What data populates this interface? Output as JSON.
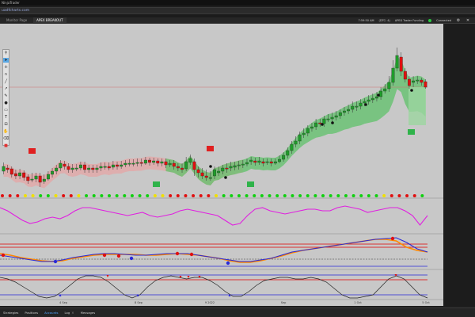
{
  "window": {
    "title": "NinjaTrader"
  },
  "browser": {
    "url": "uadfcharts.com"
  },
  "toolbar": {
    "tabs": [
      {
        "label": "Monitor Page"
      },
      {
        "label": "APEX BREAKOUT"
      }
    ],
    "time": "7:59:50 AM",
    "balance": "(DTC: 4)",
    "indicator_name": "APEX Trader Funding",
    "connection_label": "Connected"
  },
  "drawing_tools": [
    {
      "icon": "pin-icon"
    },
    {
      "icon": "cursor-icon"
    },
    {
      "icon": "crosshair-icon"
    },
    {
      "icon": "magnet-icon"
    },
    {
      "icon": "line-icon"
    },
    {
      "icon": "ray-icon"
    },
    {
      "icon": "pencil-icon"
    },
    {
      "icon": "dot-icon"
    },
    {
      "icon": "rectangle-icon"
    },
    {
      "icon": "text-icon"
    },
    {
      "icon": "ruler-icon"
    },
    {
      "icon": "hand-icon"
    },
    {
      "icon": "trash-icon"
    },
    {
      "icon": "color-icon"
    }
  ],
  "time_axis": {
    "labels": [
      "4 Sep",
      "8 Sep",
      "9 2022",
      "Sep",
      "1 Oct",
      "5 Oct"
    ]
  },
  "bottom_tabs": [
    {
      "label": "Strategies"
    },
    {
      "label": "Positions"
    },
    {
      "label": "Accounts"
    },
    {
      "label": "Log"
    },
    {
      "label": "Messages"
    }
  ],
  "colors": {
    "bull": "#1f9c2a",
    "bear": "#e01010",
    "band_green": "#5fc26a",
    "band_red": "#e7a3a3",
    "oscillator": "#e020e0",
    "macd_blue": "#2a2ad8",
    "macd_orange": "#ff8800"
  },
  "chart_data": {
    "type": "candlestick",
    "candles": [
      {
        "o": 216,
        "c": 210,
        "h": 205,
        "l": 220
      },
      {
        "o": 212,
        "c": 214,
        "h": 208,
        "l": 218
      },
      {
        "o": 213,
        "c": 220,
        "h": 210,
        "l": 224
      },
      {
        "o": 219,
        "c": 222,
        "h": 214,
        "l": 226
      },
      {
        "o": 222,
        "c": 218,
        "h": 213,
        "l": 226
      },
      {
        "o": 218,
        "c": 224,
        "h": 215,
        "l": 228
      },
      {
        "o": 223,
        "c": 228,
        "h": 220,
        "l": 232
      },
      {
        "o": 226,
        "c": 226,
        "h": 218,
        "l": 230
      },
      {
        "o": 226,
        "c": 222,
        "h": 218,
        "l": 230
      },
      {
        "o": 222,
        "c": 230,
        "h": 218,
        "l": 236
      },
      {
        "o": 229,
        "c": 226,
        "h": 220,
        "l": 232
      },
      {
        "o": 226,
        "c": 220,
        "h": 216,
        "l": 228
      },
      {
        "o": 220,
        "c": 216,
        "h": 212,
        "l": 224
      },
      {
        "o": 216,
        "c": 212,
        "h": 208,
        "l": 220
      },
      {
        "o": 212,
        "c": 206,
        "h": 202,
        "l": 216
      },
      {
        "o": 207,
        "c": 210,
        "h": 203,
        "l": 214
      },
      {
        "o": 210,
        "c": 214,
        "h": 206,
        "l": 218
      },
      {
        "o": 214,
        "c": 212,
        "h": 207,
        "l": 218
      },
      {
        "o": 212,
        "c": 212,
        "h": 207,
        "l": 216
      },
      {
        "o": 212,
        "c": 208,
        "h": 204,
        "l": 215
      },
      {
        "o": 208,
        "c": 214,
        "h": 204,
        "l": 218
      },
      {
        "o": 214,
        "c": 212,
        "h": 208,
        "l": 218
      },
      {
        "o": 212,
        "c": 214,
        "h": 208,
        "l": 218
      },
      {
        "o": 214,
        "c": 212,
        "h": 208,
        "l": 218
      },
      {
        "o": 212,
        "c": 210,
        "h": 205,
        "l": 216
      },
      {
        "o": 210,
        "c": 210,
        "h": 205,
        "l": 214
      },
      {
        "o": 210,
        "c": 212,
        "h": 205,
        "l": 215
      },
      {
        "o": 211,
        "c": 208,
        "h": 203,
        "l": 214
      },
      {
        "o": 208,
        "c": 210,
        "h": 204,
        "l": 214
      },
      {
        "o": 210,
        "c": 208,
        "h": 203,
        "l": 213
      },
      {
        "o": 208,
        "c": 206,
        "h": 202,
        "l": 211
      },
      {
        "o": 206,
        "c": 206,
        "h": 201,
        "l": 210
      },
      {
        "o": 206,
        "c": 206,
        "h": 201,
        "l": 210
      },
      {
        "o": 206,
        "c": 205,
        "h": 200,
        "l": 210
      },
      {
        "o": 205,
        "c": 206,
        "h": 200,
        "l": 210
      },
      {
        "o": 206,
        "c": 202,
        "h": 198,
        "l": 208
      },
      {
        "o": 202,
        "c": 205,
        "h": 199,
        "l": 209
      },
      {
        "o": 205,
        "c": 203,
        "h": 199,
        "l": 208
      },
      {
        "o": 203,
        "c": 206,
        "h": 200,
        "l": 210
      },
      {
        "o": 206,
        "c": 204,
        "h": 200,
        "l": 210
      },
      {
        "o": 204,
        "c": 208,
        "h": 200,
        "l": 212
      },
      {
        "o": 208,
        "c": 206,
        "h": 202,
        "l": 211
      },
      {
        "o": 206,
        "c": 210,
        "h": 202,
        "l": 214
      },
      {
        "o": 210,
        "c": 212,
        "h": 206,
        "l": 216
      },
      {
        "o": 212,
        "c": 214,
        "h": 206,
        "l": 218
      },
      {
        "o": 213,
        "c": 204,
        "h": 198,
        "l": 216
      },
      {
        "o": 205,
        "c": 200,
        "h": 195,
        "l": 208
      },
      {
        "o": 204,
        "c": 214,
        "h": 200,
        "l": 222
      },
      {
        "o": 214,
        "c": 218,
        "h": 210,
        "l": 224
      },
      {
        "o": 218,
        "c": 222,
        "h": 212,
        "l": 226
      },
      {
        "o": 222,
        "c": 224,
        "h": 214,
        "l": 228
      },
      {
        "o": 224,
        "c": 224,
        "h": 216,
        "l": 228
      },
      {
        "o": 222,
        "c": 214,
        "h": 210,
        "l": 226
      },
      {
        "o": 218,
        "c": 216,
        "h": 210,
        "l": 222
      },
      {
        "o": 216,
        "c": 212,
        "h": 208,
        "l": 220
      },
      {
        "o": 212,
        "c": 213,
        "h": 206,
        "l": 218
      },
      {
        "o": 212,
        "c": 210,
        "h": 204,
        "l": 216
      },
      {
        "o": 211,
        "c": 209,
        "h": 204,
        "l": 215
      },
      {
        "o": 209,
        "c": 208,
        "h": 203,
        "l": 214
      },
      {
        "o": 208,
        "c": 207,
        "h": 202,
        "l": 212
      },
      {
        "o": 207,
        "c": 205,
        "h": 200,
        "l": 210
      },
      {
        "o": 204,
        "c": 202,
        "h": 198,
        "l": 208
      },
      {
        "o": 203,
        "c": 205,
        "h": 199,
        "l": 209
      },
      {
        "o": 205,
        "c": 203,
        "h": 198,
        "l": 208
      },
      {
        "o": 204,
        "c": 206,
        "h": 200,
        "l": 210
      },
      {
        "o": 205,
        "c": 204,
        "h": 200,
        "l": 208
      },
      {
        "o": 204,
        "c": 206,
        "h": 200,
        "l": 210
      },
      {
        "o": 206,
        "c": 204,
        "h": 200,
        "l": 208
      },
      {
        "o": 204,
        "c": 201,
        "h": 196,
        "l": 206
      },
      {
        "o": 201,
        "c": 196,
        "h": 192,
        "l": 204
      },
      {
        "o": 196,
        "c": 190,
        "h": 186,
        "l": 200
      },
      {
        "o": 190,
        "c": 182,
        "h": 178,
        "l": 194
      },
      {
        "o": 182,
        "c": 178,
        "h": 172,
        "l": 186
      },
      {
        "o": 178,
        "c": 170,
        "h": 166,
        "l": 182
      },
      {
        "o": 170,
        "c": 168,
        "h": 162,
        "l": 174
      },
      {
        "o": 168,
        "c": 162,
        "h": 158,
        "l": 172
      },
      {
        "o": 162,
        "c": 160,
        "h": 155,
        "l": 166
      },
      {
        "o": 160,
        "c": 155,
        "h": 150,
        "l": 164
      },
      {
        "o": 155,
        "c": 156,
        "h": 150,
        "l": 160
      },
      {
        "o": 156,
        "c": 150,
        "h": 146,
        "l": 160
      },
      {
        "o": 150,
        "c": 150,
        "h": 144,
        "l": 154
      },
      {
        "o": 150,
        "c": 148,
        "h": 142,
        "l": 154
      },
      {
        "o": 148,
        "c": 146,
        "h": 140,
        "l": 152
      },
      {
        "o": 146,
        "c": 142,
        "h": 138,
        "l": 150
      },
      {
        "o": 142,
        "c": 140,
        "h": 135,
        "l": 146
      },
      {
        "o": 140,
        "c": 138,
        "h": 132,
        "l": 144
      },
      {
        "o": 138,
        "c": 134,
        "h": 128,
        "l": 142
      },
      {
        "o": 134,
        "c": 134,
        "h": 128,
        "l": 140
      },
      {
        "o": 134,
        "c": 130,
        "h": 125,
        "l": 138
      },
      {
        "o": 130,
        "c": 128,
        "h": 124,
        "l": 134
      },
      {
        "o": 128,
        "c": 126,
        "h": 120,
        "l": 132
      },
      {
        "o": 126,
        "c": 124,
        "h": 118,
        "l": 130
      },
      {
        "o": 124,
        "c": 122,
        "h": 116,
        "l": 128
      },
      {
        "o": 122,
        "c": 115,
        "h": 110,
        "l": 126
      },
      {
        "o": 115,
        "c": 112,
        "h": 106,
        "l": 118
      },
      {
        "o": 112,
        "c": 104,
        "h": 96,
        "l": 116
      },
      {
        "o": 104,
        "c": 86,
        "h": 76,
        "l": 108
      },
      {
        "o": 86,
        "c": 70,
        "h": 60,
        "l": 90
      },
      {
        "o": 72,
        "c": 90,
        "h": 66,
        "l": 96
      },
      {
        "o": 90,
        "c": 100,
        "h": 86,
        "l": 104
      },
      {
        "o": 100,
        "c": 108,
        "h": 96,
        "l": 112
      },
      {
        "o": 104,
        "c": 102,
        "h": 96,
        "l": 110
      },
      {
        "o": 102,
        "c": 101,
        "h": 96,
        "l": 106
      },
      {
        "o": 101,
        "c": 104,
        "h": 98,
        "l": 108
      },
      {
        "o": 103,
        "c": 110,
        "h": 100,
        "l": 112
      }
    ],
    "signal_dots": [
      "red",
      "red",
      "red",
      "yellow",
      "yellow",
      "green",
      "green",
      "yellow",
      "red",
      "red",
      "yellow",
      "green",
      "green",
      "green",
      "green",
      "green",
      "green",
      "green",
      "green",
      "green",
      "yellow",
      "yellow",
      "red",
      "red",
      "red",
      "red",
      "red",
      "red",
      "yellow",
      "green",
      "green",
      "green",
      "green",
      "green",
      "green",
      "green",
      "green",
      "green",
      "green",
      "green",
      "green",
      "green",
      "green",
      "green",
      "green",
      "green",
      "green",
      "green",
      "green",
      "green",
      "yellow",
      "red",
      "red",
      "red",
      "red",
      "green"
    ],
    "oscillator": [
      262,
      266,
      272,
      278,
      282,
      280,
      276,
      274,
      276,
      272,
      266,
      262,
      262,
      264,
      266,
      268,
      270,
      272,
      270,
      268,
      272,
      274,
      272,
      270,
      266,
      264,
      266,
      268,
      270,
      272,
      278,
      284,
      282,
      272,
      264,
      262,
      266,
      268,
      270,
      268,
      266,
      264,
      264,
      266,
      266,
      262,
      260,
      262,
      264,
      268,
      266,
      264,
      262,
      262,
      266,
      272,
      284,
      272
    ],
    "macd_blue": [
      322,
      324,
      326,
      328,
      330,
      330,
      328,
      325,
      323,
      321,
      320,
      320,
      321,
      322,
      322,
      321,
      320,
      320,
      320,
      322,
      324,
      326,
      328,
      330,
      330,
      328,
      326,
      322,
      318,
      316,
      314,
      312,
      310,
      308,
      306,
      304,
      302,
      301,
      300,
      306,
      314,
      318
    ],
    "macd_orange": [
      320,
      322,
      325,
      327,
      329,
      330,
      329,
      326,
      324,
      322,
      321,
      321,
      321,
      321,
      322,
      322,
      321,
      320,
      321,
      322,
      324,
      326,
      329,
      331,
      331,
      329,
      326,
      323,
      319,
      316,
      314,
      312,
      310,
      308,
      306,
      304,
      302,
      302,
      304,
      312,
      316,
      318
    ],
    "stoch": [
      350,
      352,
      356,
      362,
      368,
      374,
      376,
      374,
      368,
      360,
      352,
      348,
      348,
      350,
      356,
      364,
      372,
      376,
      372,
      362,
      354,
      350,
      348,
      350,
      352,
      350,
      350,
      354,
      360,
      368,
      374,
      374,
      368,
      360,
      354,
      352,
      350,
      350,
      352,
      352,
      350,
      352,
      356,
      364,
      372,
      376,
      376,
      374,
      372,
      362,
      352,
      348,
      352,
      362,
      372,
      376
    ]
  }
}
